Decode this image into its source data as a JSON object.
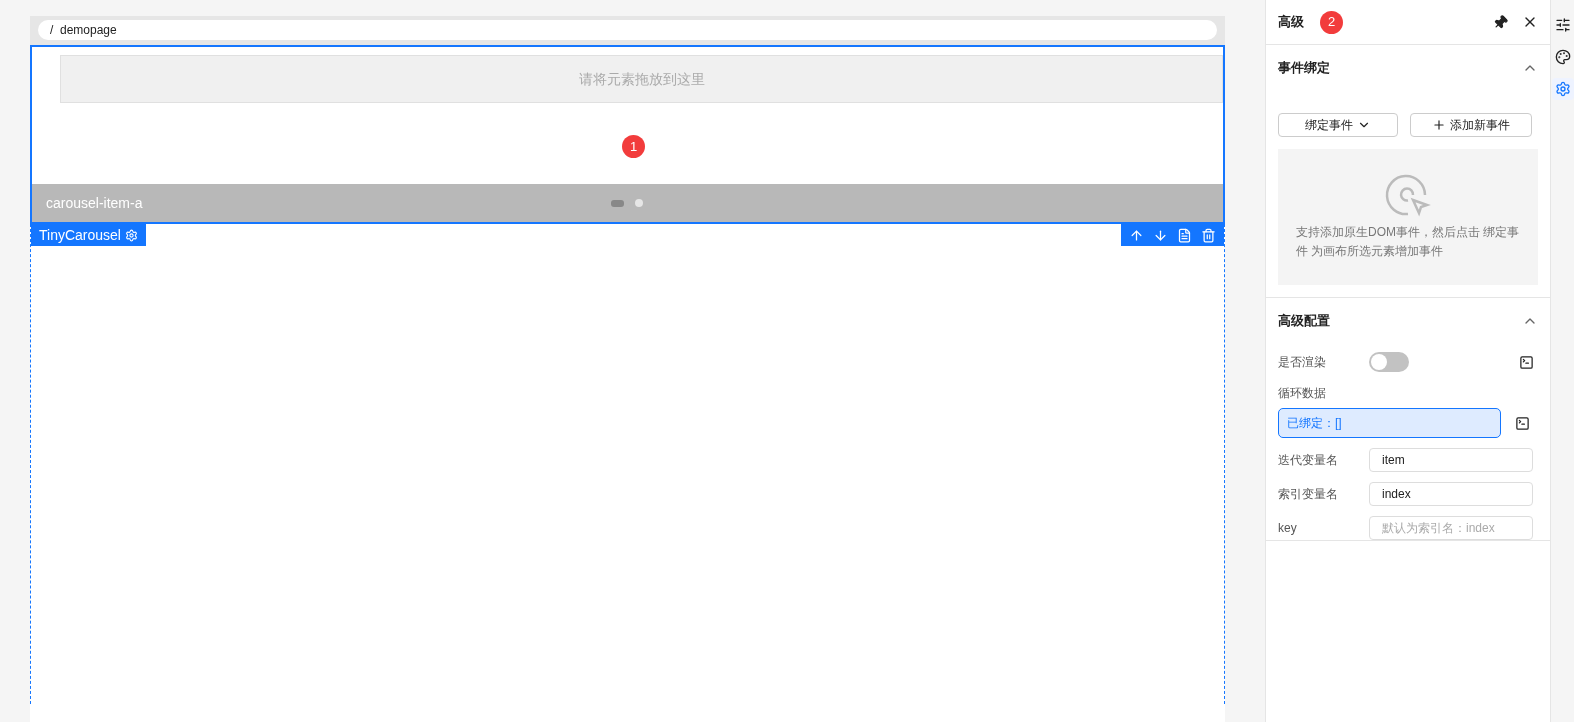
{
  "breadcrumb": "/  demopage",
  "canvas": {
    "drop_hint": "请将元素拖放到这里",
    "badge": "1",
    "carousel_item": "carousel-item-a",
    "indicators": [
      {
        "selected": true
      },
      {
        "selected": false
      }
    ],
    "component_label": "TinyCarousel"
  },
  "panel": {
    "title": "高级",
    "badge": "2",
    "events": {
      "title": "事件绑定",
      "expanded": true,
      "bind_button": "绑定事件",
      "add_button": "添加新事件",
      "empty_text": "支持添加原生DOM事件，然后点击 绑定事件 为画布所选元素增加事件"
    },
    "advanced": {
      "title": "高级配置",
      "expanded": true,
      "rows": [
        {
          "kind": "switch",
          "label": "是否渲染",
          "on": false
        },
        {
          "kind": "bound",
          "label": "循环数据",
          "value": "已绑定：[]"
        },
        {
          "kind": "input",
          "label": "迭代变量名",
          "value": "item"
        },
        {
          "kind": "input",
          "label": "索引变量名",
          "value": "index"
        },
        {
          "kind": "input",
          "label": "key",
          "placeholder": "默认为索引名：index"
        }
      ]
    }
  },
  "side_tabs": [
    {
      "selected": false
    },
    {
      "selected": false
    },
    {
      "selected": true
    }
  ]
}
